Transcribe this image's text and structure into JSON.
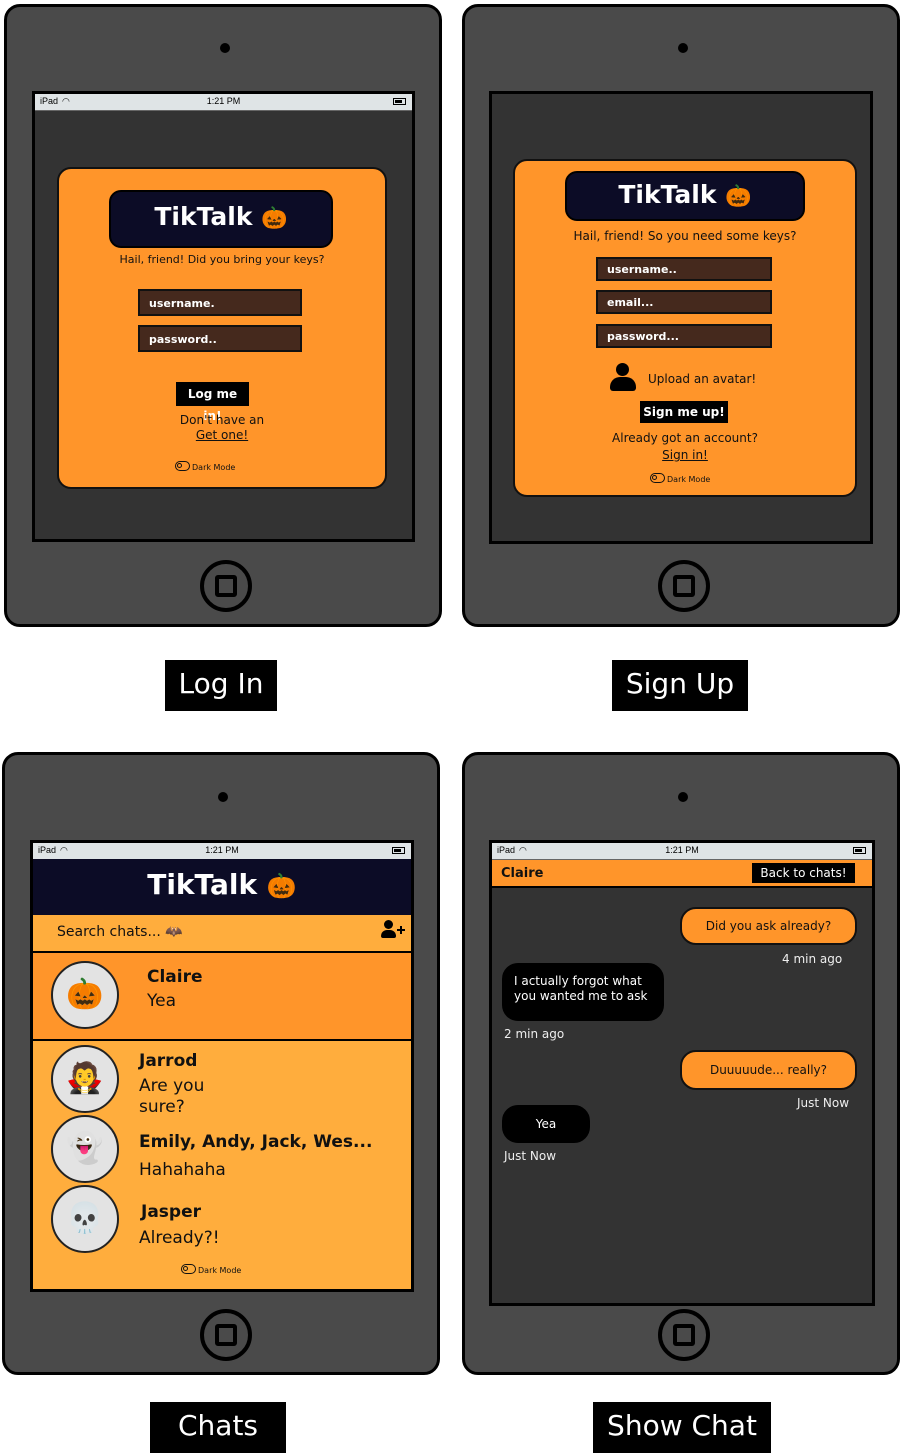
{
  "statusbar": {
    "device": "iPad",
    "time": "1:21 PM"
  },
  "login": {
    "brand": "TikTalk",
    "brand_emoji": "🎃",
    "tagline": "Hail, friend! Did you bring your keys?",
    "username_placeholder": "username.",
    "password_placeholder": "password..",
    "login_button": "Log me in!",
    "no_account": "Don't have an",
    "get_one": "Get one!",
    "dark_mode": "Dark Mode",
    "caption": "Log In"
  },
  "signup": {
    "brand": "TikTalk",
    "brand_emoji": "🎃",
    "tagline": "Hail, friend! So you need some keys?",
    "username_placeholder": "username..",
    "email_placeholder": "email...",
    "password_placeholder": "password...",
    "upload_avatar": "Upload an avatar!",
    "signup_button": "Sign me up!",
    "already": "Already got an account?",
    "sign_in": "Sign in!",
    "dark_mode": "Dark Mode",
    "caption": "Sign Up"
  },
  "chats": {
    "brand": "TikTalk",
    "brand_emoji": "🎃",
    "search_placeholder": "Search chats... 🦇",
    "items": [
      {
        "name": "Claire",
        "message": "Yea",
        "emoji": "🎃"
      },
      {
        "name": "Jarrod",
        "message": "Are you sure?",
        "emoji": "🧛"
      },
      {
        "name": "Emily, Andy, Jack, Wes...",
        "message": "Hahahaha",
        "emoji": "👻"
      },
      {
        "name": "Jasper",
        "message": "Already?!",
        "emoji": "💀"
      }
    ],
    "dark_mode": "Dark Mode",
    "caption": "Chats"
  },
  "showchat": {
    "contact": "Claire",
    "back_button": "Back to chats!",
    "messages": [
      {
        "text": "Did you ask already?",
        "time": "4 min ago"
      },
      {
        "text": "I actually forgot what you wanted me to ask",
        "time": "2 min ago"
      },
      {
        "text": "Duuuuude... really?",
        "time": "Just Now"
      },
      {
        "text": "Yea",
        "time": "Just Now"
      }
    ],
    "caption": "Show Chat"
  },
  "colors": {
    "orange": "#ff952a",
    "light_orange": "#ffad3d",
    "navy": "#0c0c26",
    "device": "#4a4a4a",
    "screen": "#333333"
  }
}
